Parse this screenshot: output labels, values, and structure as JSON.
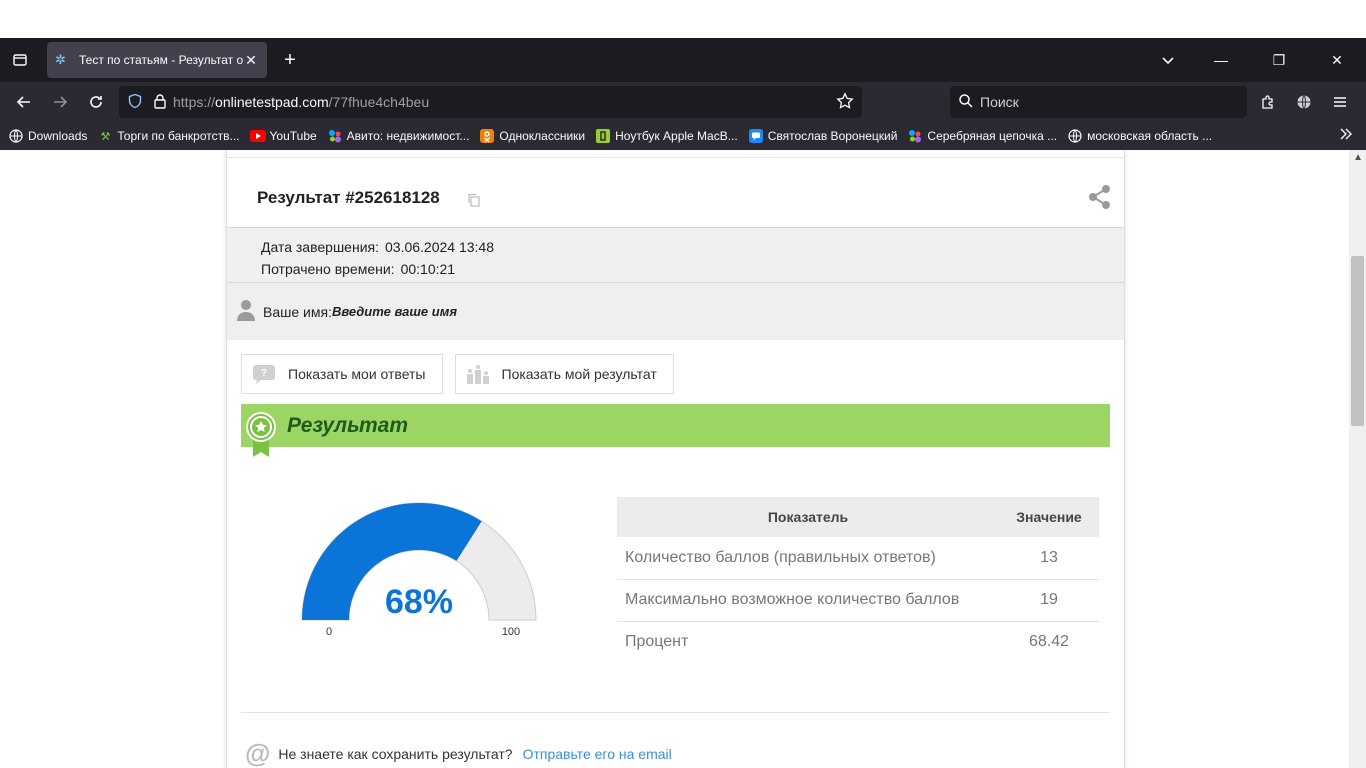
{
  "browser": {
    "tab_title": "Тест по статьям - Результат онлайн",
    "url_domain": "onlinetestpad.com",
    "url_path": "/77fhue4ch4beu",
    "url_scheme": "https://",
    "search_placeholder": "Поиск",
    "bookmarks": [
      {
        "label": "Downloads",
        "icon": "globe-icon"
      },
      {
        "label": "Торги по банкротств...",
        "icon": "hammer-icon"
      },
      {
        "label": "YouTube",
        "icon": "youtube-icon"
      },
      {
        "label": "Авито: недвижимост...",
        "icon": "avito-icon"
      },
      {
        "label": "Одноклассники",
        "icon": "ok-icon"
      },
      {
        "label": "Ноутбук Apple MacB...",
        "icon": "shop-icon"
      },
      {
        "label": "Святослав Воронецкий",
        "icon": "chat-icon"
      },
      {
        "label": "Серебряная цепочка ...",
        "icon": "avito-icon"
      },
      {
        "label": "московская область ...",
        "icon": "globe-icon"
      }
    ]
  },
  "page": {
    "result_title": "Результат #252618128",
    "finish_label": "Дата завершения:",
    "finish_value": "03.06.2024 13:48",
    "time_label": "Потрачено времени:",
    "time_value": "00:10:21",
    "name_label": "Ваше имя:",
    "name_placeholder": "Введите ваше имя",
    "btn_answers": "Показать мои ответы",
    "btn_result": "Показать мой результат",
    "section_title": "Результат",
    "gauge": {
      "value": 68,
      "label": "68%",
      "min_label": "0",
      "max_label": "100",
      "fill_color": "#0b74d8",
      "rest_color": "#ececec"
    },
    "table": {
      "col1": "Показатель",
      "col2": "Значение",
      "rows": [
        {
          "name": "Количество баллов (правильных ответов)",
          "value": "13"
        },
        {
          "name": "Максимально возможное количество баллов",
          "value": "19"
        },
        {
          "name": "Процент",
          "value": "68.42"
        }
      ]
    },
    "save_text": "Не знаете как сохранить результат?",
    "save_link": "Отправьте его на email"
  }
}
